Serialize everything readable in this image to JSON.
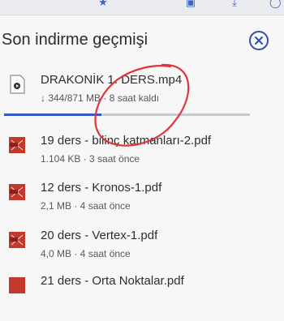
{
  "panel": {
    "title": "Son indirme geçmişi",
    "close_icon": "close-circle-icon"
  },
  "active_download": {
    "name": "DRAKONİK 1. DERS.mp4",
    "progress_text": "↓ 344/871 MB · 8 saat kaldı",
    "progress_fraction": 0.395,
    "icon": "video-file-icon"
  },
  "history": [
    {
      "name": "19 ders - bilinç katmanları-2.pdf",
      "meta": "1.104 KB · 3 saat önce",
      "icon": "pdf-file-icon"
    },
    {
      "name": "12 ders - Kronos-1.pdf",
      "meta": "2,1 MB · 4 saat önce",
      "icon": "pdf-file-icon"
    },
    {
      "name": "20 ders - Vertex-1.pdf",
      "meta": "4,0 MB · 4 saat önce",
      "icon": "pdf-file-icon"
    },
    {
      "name": "21 ders - Orta Noktalar.pdf",
      "meta": "",
      "icon": "pdf-file-icon"
    }
  ],
  "colors": {
    "accent": "#2f5bd0",
    "annotation": "#e0353c",
    "pdf_icon": "#c0392b"
  }
}
